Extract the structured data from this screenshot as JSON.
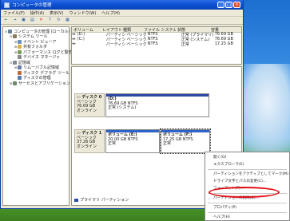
{
  "window": {
    "title": "コンピュータの管理"
  },
  "menu": [
    "ファイル(F)",
    "操作(A)",
    "表示(V)",
    "ウィンドウ(W)",
    "ヘルプ(H)"
  ],
  "toolbar": [
    "back-icon",
    "forward-icon",
    "up-icon",
    "properties-icon",
    "delete-icon",
    "help-icon",
    "refresh-icon",
    "view-icon"
  ],
  "tree": [
    {
      "label": "コンピュータの管理 (ローカル)",
      "level": 0,
      "exp": "-",
      "icon": "computer-icon",
      "color": "#6a7f9a"
    },
    {
      "label": "システム ツール",
      "level": 1,
      "exp": "-",
      "icon": "tools-icon",
      "color": "#8a7a5a"
    },
    {
      "label": "イベント ビューア",
      "level": 2,
      "exp": "+",
      "icon": "event-viewer-icon",
      "color": "#6b8ebc"
    },
    {
      "label": "共有フォルダ",
      "level": 2,
      "exp": "+",
      "icon": "shared-folder-icon",
      "color": "#d8b042"
    },
    {
      "label": "パフォーマンス ログと警告",
      "level": 2,
      "exp": "+",
      "icon": "performance-icon",
      "color": "#7a9a5a"
    },
    {
      "label": "デバイス マネージャ",
      "level": 2,
      "exp": "",
      "icon": "device-manager-icon",
      "color": "#8a8a8a"
    },
    {
      "label": "記憶域",
      "level": 1,
      "exp": "-",
      "icon": "storage-icon",
      "color": "#7f8a9a"
    },
    {
      "label": "リムーバブル記憶域",
      "level": 2,
      "exp": "+",
      "icon": "removable-storage-icon",
      "color": "#6a7aa0"
    },
    {
      "label": "ディスク デフラグ ツール",
      "level": 2,
      "exp": "",
      "icon": "defrag-icon",
      "color": "#c06a3a"
    },
    {
      "label": "ディスクの管理",
      "level": 2,
      "exp": "",
      "icon": "disk-management-icon",
      "color": "#5a7aa8"
    },
    {
      "label": "サービスとアプリケーション",
      "level": 1,
      "exp": "+",
      "icon": "services-icon",
      "color": "#6a8a6a"
    }
  ],
  "volumes": {
    "headers": [
      "ボリューム",
      "レイアウト",
      "種類",
      "ファイル システム",
      "状態",
      "容量"
    ],
    "rows": [
      [
        "(D:)",
        "パーティション",
        "ベーシック",
        "NTFS",
        "正常 (プライマリ)",
        "76.69 GB"
      ],
      [
        "(C:)",
        "パーティション",
        "ベーシック",
        "NTFS",
        "正常 (システム)",
        "76.69 GB"
      ],
      [
        "",
        "パーティション",
        "ベーシック",
        "NTFS",
        "正常",
        "17.25 GB"
      ]
    ]
  },
  "disks": [
    {
      "name": "ディスク 0",
      "type": "ベーシック",
      "size": "76.69 GB",
      "status": "オンライン",
      "partitions": [
        {
          "name": "(D:)",
          "size": "76.69 GB NTFS",
          "status": "正常 (システム)"
        }
      ]
    },
    {
      "name": "ディスク 1",
      "type": "ベーシック",
      "size": "37.26 GB",
      "status": "オンライン",
      "partitions": [
        {
          "name": "ボリューム (E:)",
          "size": "20.00 GB NTFS",
          "status": "正常"
        },
        {
          "name": "ボリューム (F:)",
          "size": "17.25 GB NTFS",
          "status": "正常"
        }
      ]
    }
  ],
  "legend": "プライマリ パーティション",
  "context_menu": [
    "開く(O)",
    "エクスプローラ(E)",
    "---",
    "パーティションをアクティブとしてマーク(M)",
    "ドライブ文字とパスの変更(C)...",
    "フォーマット(F)...",
    "---",
    "パーティションの削除(D)...",
    "---",
    "プロパティ(P)",
    "---",
    "ヘルプ(H)"
  ],
  "highlighted_menu_item": "パーティションの削除(D)...",
  "colors": {
    "titlebar": "#0b4fd0",
    "primary_partition": "#2d4aa8",
    "highlight": "#e00d16"
  }
}
